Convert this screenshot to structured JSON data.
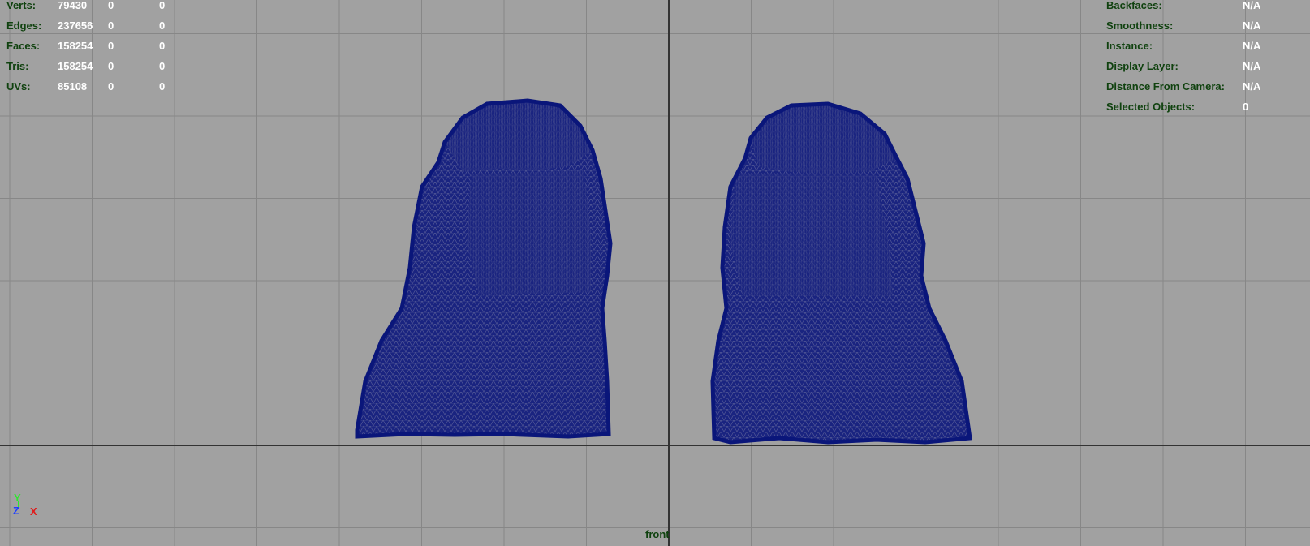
{
  "viewport": {
    "camera": "front",
    "background_color": "#a1a1a1",
    "grid_color": "#878787",
    "axis_color": "#333333",
    "wireframe_color": "#0c1a7a"
  },
  "stats": {
    "rows": [
      {
        "label": "Verts:",
        "v1": "79430",
        "v2": "0",
        "v3": "0"
      },
      {
        "label": "Edges:",
        "v1": "237656",
        "v2": "0",
        "v3": "0"
      },
      {
        "label": "Faces:",
        "v1": "158254",
        "v2": "0",
        "v3": "0"
      },
      {
        "label": "Tris:",
        "v1": "158254",
        "v2": "0",
        "v3": "0"
      },
      {
        "label": "UVs:",
        "v1": "85108",
        "v2": "0",
        "v3": "0"
      }
    ]
  },
  "object_details": {
    "rows": [
      {
        "label": "Backfaces:",
        "value": "N/A"
      },
      {
        "label": "Smoothness:",
        "value": "N/A"
      },
      {
        "label": "Instance:",
        "value": "N/A"
      },
      {
        "label": "Display Layer:",
        "value": "N/A"
      },
      {
        "label": "Distance From Camera:",
        "value": "N/A"
      },
      {
        "label": "Selected Objects:",
        "value": "0"
      }
    ]
  },
  "axis_gizmo": {
    "y": "Y",
    "z": "Z",
    "x": "X"
  },
  "models": [
    {
      "name": "left-shoe-wireframe"
    },
    {
      "name": "right-shoe-wireframe"
    }
  ]
}
